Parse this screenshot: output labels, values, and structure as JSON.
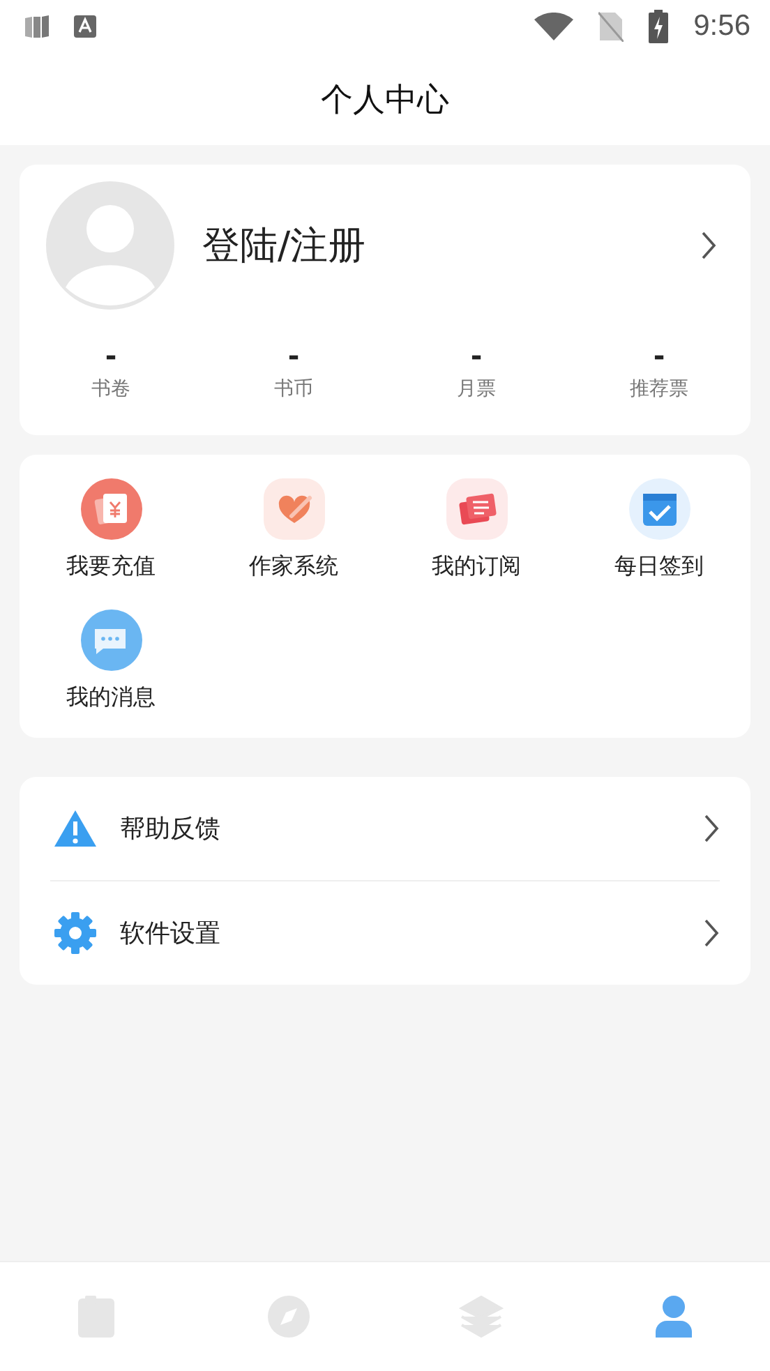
{
  "status_bar": {
    "time": "9:56"
  },
  "header": {
    "title": "个人中心"
  },
  "profile": {
    "name": "登陆/注册",
    "stats": [
      {
        "value": "-",
        "label": "书卷"
      },
      {
        "value": "-",
        "label": "书币"
      },
      {
        "value": "-",
        "label": "月票"
      },
      {
        "value": "-",
        "label": "推荐票"
      }
    ]
  },
  "shortcuts": [
    {
      "kind": "recharge",
      "label": "我要充值"
    },
    {
      "kind": "writer",
      "label": "作家系统"
    },
    {
      "kind": "subscription",
      "label": "我的订阅"
    },
    {
      "kind": "checkin",
      "label": "每日签到"
    },
    {
      "kind": "messages",
      "label": "我的消息"
    }
  ],
  "menu": [
    {
      "kind": "help",
      "label": "帮助反馈"
    },
    {
      "kind": "settings",
      "label": "软件设置"
    }
  ],
  "bottom_nav": [
    {
      "kind": "bookshelf",
      "selected": false
    },
    {
      "kind": "discover",
      "selected": false
    },
    {
      "kind": "category",
      "selected": false
    },
    {
      "kind": "profile",
      "selected": true
    }
  ]
}
